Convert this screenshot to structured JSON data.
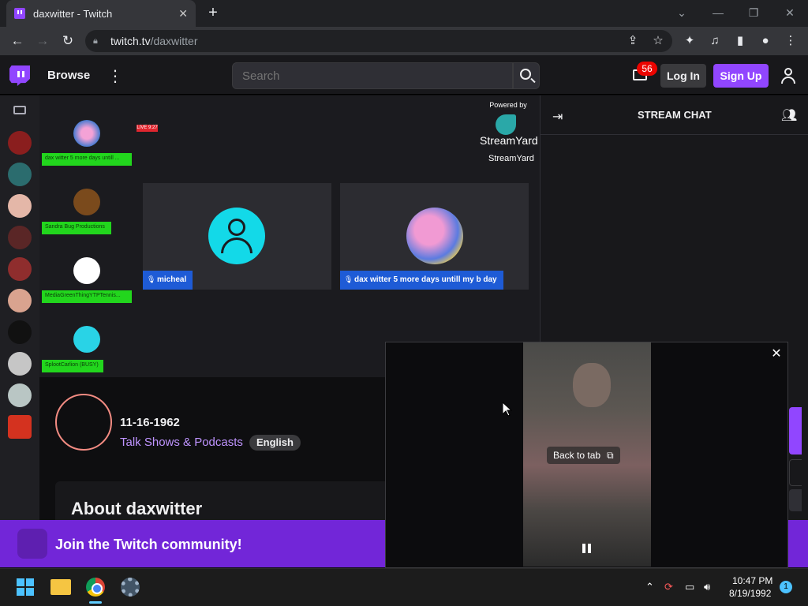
{
  "browser": {
    "tab_title": "daxwitter - Twitch",
    "tab_close": "✕",
    "new_tab": "+",
    "url_host": "twitch.tv",
    "url_path": "/daxwitter"
  },
  "nav": {
    "browse": "Browse",
    "search_placeholder": "Search",
    "inbox_count": "56",
    "login": "Log In",
    "signup": "Sign Up"
  },
  "stream": {
    "live_badge": "LIVE 9:27",
    "powered_by": "Powered by",
    "streamyard": "StreamYard",
    "streamyard_small": "StreamYard",
    "guests": [
      {
        "name": "dax witter 5 more days untill ..."
      },
      {
        "name": "Sandra Bug Productions"
      },
      {
        "name": "MediaGreenThingYTPTennis..."
      },
      {
        "name": "SplootCarlion (BUSY)"
      }
    ],
    "tiles": [
      {
        "label": "micheal"
      },
      {
        "label": "dax witter 5 more days untill my b day"
      }
    ]
  },
  "channel": {
    "date_title": "11-16-1962",
    "category": "Talk Shows & Podcasts",
    "language": "English",
    "about_title": "About daxwitter"
  },
  "chat": {
    "title": "STREAM CHAT"
  },
  "banner": {
    "text": "Join the Twitch community!"
  },
  "pip": {
    "back_to_tab": "Back to tab"
  },
  "taskbar": {
    "time": "10:47 PM",
    "date": "8/19/1992",
    "notifications": "1"
  },
  "colors": {
    "twitch_purple": "#9146ff",
    "guest_tag_green": "#22d61d",
    "tile_label_blue": "#1e5bd6",
    "banner_purple": "#7226d8"
  }
}
